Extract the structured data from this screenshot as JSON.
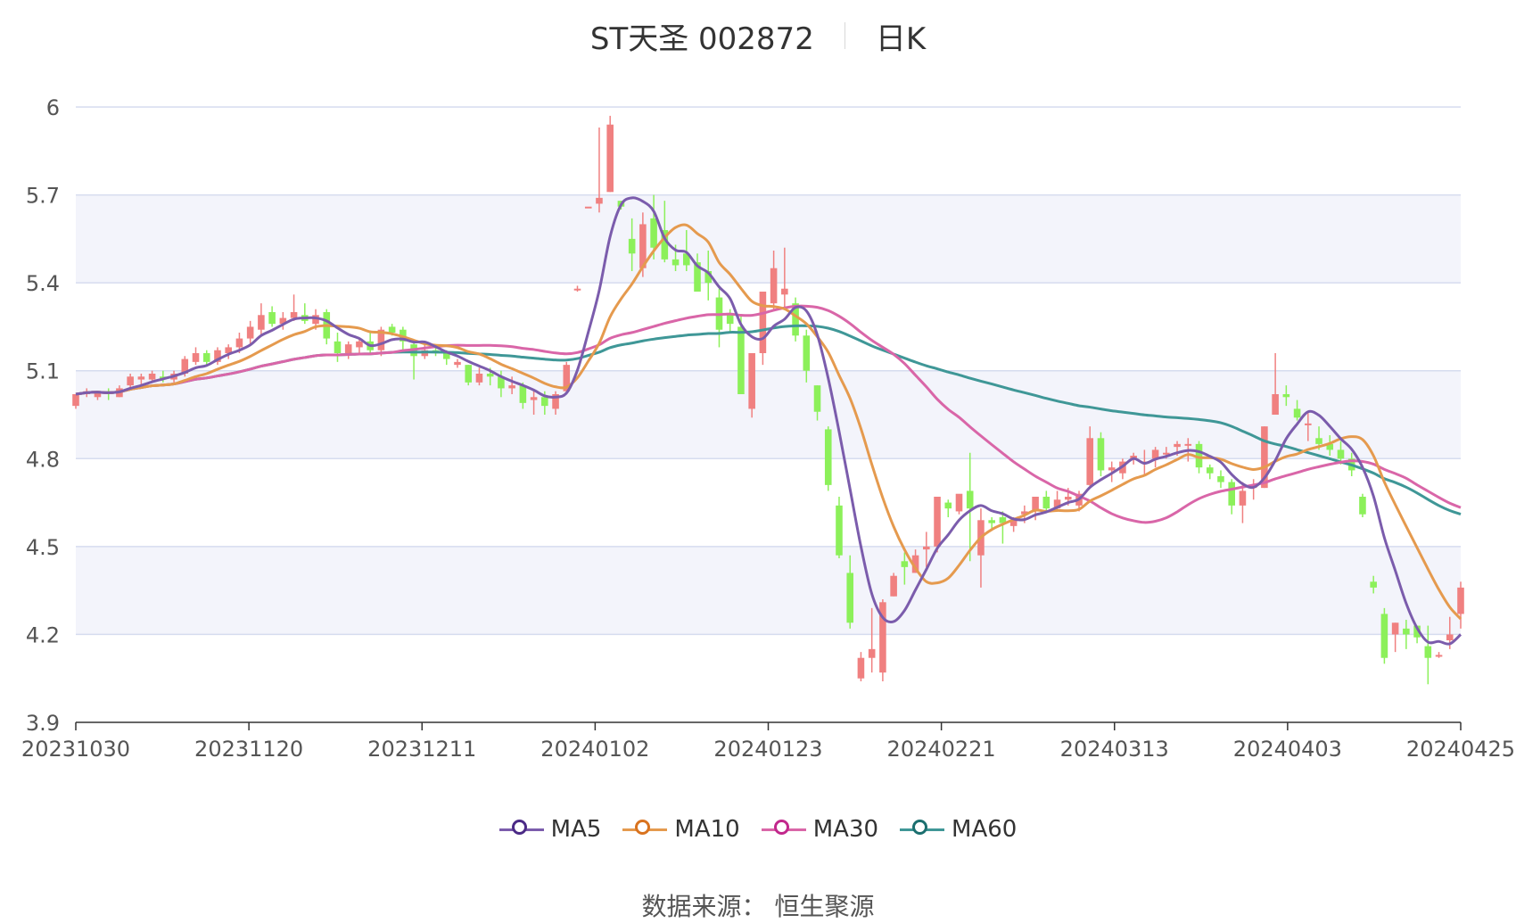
{
  "title": {
    "name": "ST天圣 002872",
    "period": "日K"
  },
  "source_label": "数据来源：  恒生聚源",
  "legend": [
    {
      "name": "MA5",
      "color": "#7b5cac",
      "dot_color": "#4b2a86"
    },
    {
      "name": "MA10",
      "color": "#e59a4e",
      "dot_color": "#d9731f"
    },
    {
      "name": "MA30",
      "color": "#d966a8",
      "dot_color": "#c2288c"
    },
    {
      "name": "MA60",
      "color": "#3f9797",
      "dot_color": "#1b6f6f"
    }
  ],
  "colors": {
    "up": "#f08080",
    "down": "#8cf05a",
    "grid": "#d6dcef",
    "band": "#f3f4fb"
  },
  "chart_data": {
    "type": "candlestick",
    "ylim": [
      3.9,
      6.0
    ],
    "y_ticks": [
      3.9,
      4.2,
      4.5,
      4.8,
      5.1,
      5.4,
      5.7,
      6
    ],
    "x_tick_labels": [
      "20231030",
      "20231120",
      "20231211",
      "20240102",
      "20240123",
      "20240221",
      "20240313",
      "20240403",
      "20240425"
    ],
    "candles_ohlc": [
      [
        4.98,
        5.02,
        4.97,
        5.02
      ],
      [
        5.02,
        5.04,
        5.01,
        5.03
      ],
      [
        5.01,
        5.03,
        5.0,
        5.03
      ],
      [
        5.03,
        5.04,
        5.0,
        5.02
      ],
      [
        5.01,
        5.05,
        5.01,
        5.04
      ],
      [
        5.05,
        5.09,
        5.04,
        5.08
      ],
      [
        5.07,
        5.09,
        5.05,
        5.08
      ],
      [
        5.07,
        5.1,
        5.06,
        5.09
      ],
      [
        5.08,
        5.1,
        5.06,
        5.07
      ],
      [
        5.07,
        5.1,
        5.06,
        5.09
      ],
      [
        5.09,
        5.15,
        5.08,
        5.14
      ],
      [
        5.13,
        5.18,
        5.12,
        5.16
      ],
      [
        5.16,
        5.17,
        5.12,
        5.13
      ],
      [
        5.13,
        5.18,
        5.12,
        5.17
      ],
      [
        5.16,
        5.19,
        5.14,
        5.18
      ],
      [
        5.18,
        5.23,
        5.16,
        5.21
      ],
      [
        5.21,
        5.27,
        5.19,
        5.25
      ],
      [
        5.24,
        5.33,
        5.22,
        5.29
      ],
      [
        5.3,
        5.32,
        5.25,
        5.26
      ],
      [
        5.26,
        5.3,
        5.24,
        5.28
      ],
      [
        5.28,
        5.36,
        5.27,
        5.3
      ],
      [
        5.29,
        5.33,
        5.26,
        5.27
      ],
      [
        5.26,
        5.31,
        5.24,
        5.29
      ],
      [
        5.3,
        5.31,
        5.19,
        5.21
      ],
      [
        5.2,
        5.23,
        5.13,
        5.16
      ],
      [
        5.16,
        5.2,
        5.14,
        5.19
      ],
      [
        5.18,
        5.21,
        5.16,
        5.2
      ],
      [
        5.2,
        5.23,
        5.16,
        5.17
      ],
      [
        5.17,
        5.25,
        5.15,
        5.24
      ],
      [
        5.25,
        5.26,
        5.22,
        5.23
      ],
      [
        5.24,
        5.25,
        5.16,
        5.2
      ],
      [
        5.19,
        5.2,
        5.07,
        5.15
      ],
      [
        5.15,
        5.19,
        5.14,
        5.17
      ],
      [
        5.17,
        5.19,
        5.15,
        5.16
      ],
      [
        5.16,
        5.17,
        5.12,
        5.14
      ],
      [
        5.12,
        5.14,
        5.11,
        5.13
      ],
      [
        5.12,
        5.12,
        5.05,
        5.06
      ],
      [
        5.06,
        5.11,
        5.05,
        5.09
      ],
      [
        5.09,
        5.11,
        5.05,
        5.08
      ],
      [
        5.08,
        5.1,
        5.01,
        5.04
      ],
      [
        5.04,
        5.08,
        5.02,
        5.05
      ],
      [
        5.05,
        5.06,
        4.97,
        4.99
      ],
      [
        5.0,
        5.03,
        4.95,
        5.01
      ],
      [
        5.01,
        5.03,
        4.95,
        4.98
      ],
      [
        4.97,
        5.03,
        4.95,
        5.02
      ],
      [
        5.03,
        5.13,
        5.02,
        5.12
      ],
      [
        5.38,
        5.39,
        5.37,
        5.38
      ],
      [
        5.66,
        5.66,
        5.66,
        5.66
      ],
      [
        5.67,
        5.93,
        5.64,
        5.69
      ],
      [
        5.71,
        5.97,
        5.71,
        5.94
      ],
      [
        5.68,
        5.68,
        5.65,
        5.66
      ],
      [
        5.55,
        5.62,
        5.44,
        5.5
      ],
      [
        5.45,
        5.64,
        5.42,
        5.6
      ],
      [
        5.62,
        5.7,
        5.48,
        5.52
      ],
      [
        5.58,
        5.68,
        5.47,
        5.48
      ],
      [
        5.48,
        5.53,
        5.44,
        5.46
      ],
      [
        5.5,
        5.58,
        5.44,
        5.46
      ],
      [
        5.47,
        5.5,
        5.4,
        5.37
      ],
      [
        5.44,
        5.51,
        5.34,
        5.4
      ],
      [
        5.35,
        5.38,
        5.18,
        5.24
      ],
      [
        5.29,
        5.31,
        5.23,
        5.26
      ],
      [
        5.25,
        5.29,
        5.02,
        5.02
      ],
      [
        4.97,
        5.16,
        4.94,
        5.16
      ],
      [
        5.16,
        5.37,
        5.12,
        5.37
      ],
      [
        5.33,
        5.51,
        5.31,
        5.45
      ],
      [
        5.36,
        5.52,
        5.31,
        5.38
      ],
      [
        5.33,
        5.35,
        5.2,
        5.22
      ],
      [
        5.22,
        5.24,
        5.06,
        5.1
      ],
      [
        5.05,
        5.05,
        4.93,
        4.96
      ],
      [
        4.9,
        4.91,
        4.69,
        4.71
      ],
      [
        4.64,
        4.67,
        4.46,
        4.47
      ],
      [
        4.41,
        4.47,
        4.22,
        4.24
      ],
      [
        4.05,
        4.14,
        4.04,
        4.12
      ],
      [
        4.12,
        4.29,
        4.07,
        4.15
      ],
      [
        4.07,
        4.32,
        4.04,
        4.31
      ],
      [
        4.33,
        4.41,
        4.33,
        4.4
      ],
      [
        4.45,
        4.48,
        4.37,
        4.43
      ],
      [
        4.41,
        4.49,
        4.41,
        4.47
      ],
      [
        4.49,
        4.55,
        4.43,
        4.5
      ],
      [
        4.5,
        4.67,
        4.48,
        4.67
      ],
      [
        4.65,
        4.66,
        4.6,
        4.63
      ],
      [
        4.62,
        4.67,
        4.61,
        4.68
      ],
      [
        4.69,
        4.82,
        4.45,
        4.63
      ],
      [
        4.47,
        4.63,
        4.36,
        4.59
      ],
      [
        4.59,
        4.6,
        4.56,
        4.58
      ],
      [
        4.6,
        4.62,
        4.51,
        4.58
      ],
      [
        4.57,
        4.6,
        4.55,
        4.59
      ],
      [
        4.61,
        4.64,
        4.58,
        4.62
      ],
      [
        4.62,
        4.64,
        4.59,
        4.67
      ],
      [
        4.67,
        4.69,
        4.62,
        4.63
      ],
      [
        4.63,
        4.69,
        4.62,
        4.66
      ],
      [
        4.66,
        4.7,
        4.64,
        4.67
      ],
      [
        4.64,
        4.69,
        4.62,
        4.68
      ],
      [
        4.71,
        4.91,
        4.7,
        4.87
      ],
      [
        4.87,
        4.89,
        4.74,
        4.76
      ],
      [
        4.76,
        4.79,
        4.72,
        4.77
      ],
      [
        4.75,
        4.8,
        4.73,
        4.79
      ],
      [
        4.8,
        4.82,
        4.78,
        4.81
      ],
      [
        4.79,
        4.83,
        4.74,
        4.79
      ],
      [
        4.8,
        4.84,
        4.77,
        4.83
      ],
      [
        4.82,
        4.84,
        4.8,
        4.82
      ],
      [
        4.84,
        4.86,
        4.81,
        4.85
      ],
      [
        4.85,
        4.87,
        4.79,
        4.85
      ],
      [
        4.85,
        4.86,
        4.75,
        4.77
      ],
      [
        4.77,
        4.78,
        4.73,
        4.75
      ],
      [
        4.74,
        4.76,
        4.7,
        4.72
      ],
      [
        4.72,
        4.73,
        4.61,
        4.64
      ],
      [
        4.64,
        4.72,
        4.58,
        4.69
      ],
      [
        4.7,
        4.73,
        4.66,
        4.71
      ],
      [
        4.7,
        4.91,
        4.7,
        4.91
      ],
      [
        4.95,
        5.16,
        4.95,
        5.02
      ],
      [
        5.02,
        5.05,
        4.98,
        5.01
      ],
      [
        4.97,
        5.0,
        4.93,
        4.94
      ],
      [
        4.92,
        4.96,
        4.86,
        4.92
      ],
      [
        4.87,
        4.91,
        4.83,
        4.85
      ],
      [
        4.85,
        4.88,
        4.81,
        4.83
      ],
      [
        4.83,
        4.86,
        4.78,
        4.8
      ],
      [
        4.8,
        4.82,
        4.74,
        4.76
      ],
      [
        4.67,
        4.68,
        4.6,
        4.61
      ],
      [
        4.38,
        4.4,
        4.34,
        4.36
      ],
      [
        4.27,
        4.29,
        4.1,
        4.12
      ],
      [
        4.2,
        4.24,
        4.14,
        4.24
      ],
      [
        4.22,
        4.25,
        4.15,
        4.2
      ],
      [
        4.23,
        4.23,
        4.17,
        4.19
      ],
      [
        4.16,
        4.23,
        4.03,
        4.12
      ],
      [
        4.13,
        4.14,
        4.12,
        4.13
      ],
      [
        4.18,
        4.26,
        4.15,
        4.2
      ],
      [
        4.27,
        4.38,
        4.22,
        4.36
      ]
    ]
  }
}
